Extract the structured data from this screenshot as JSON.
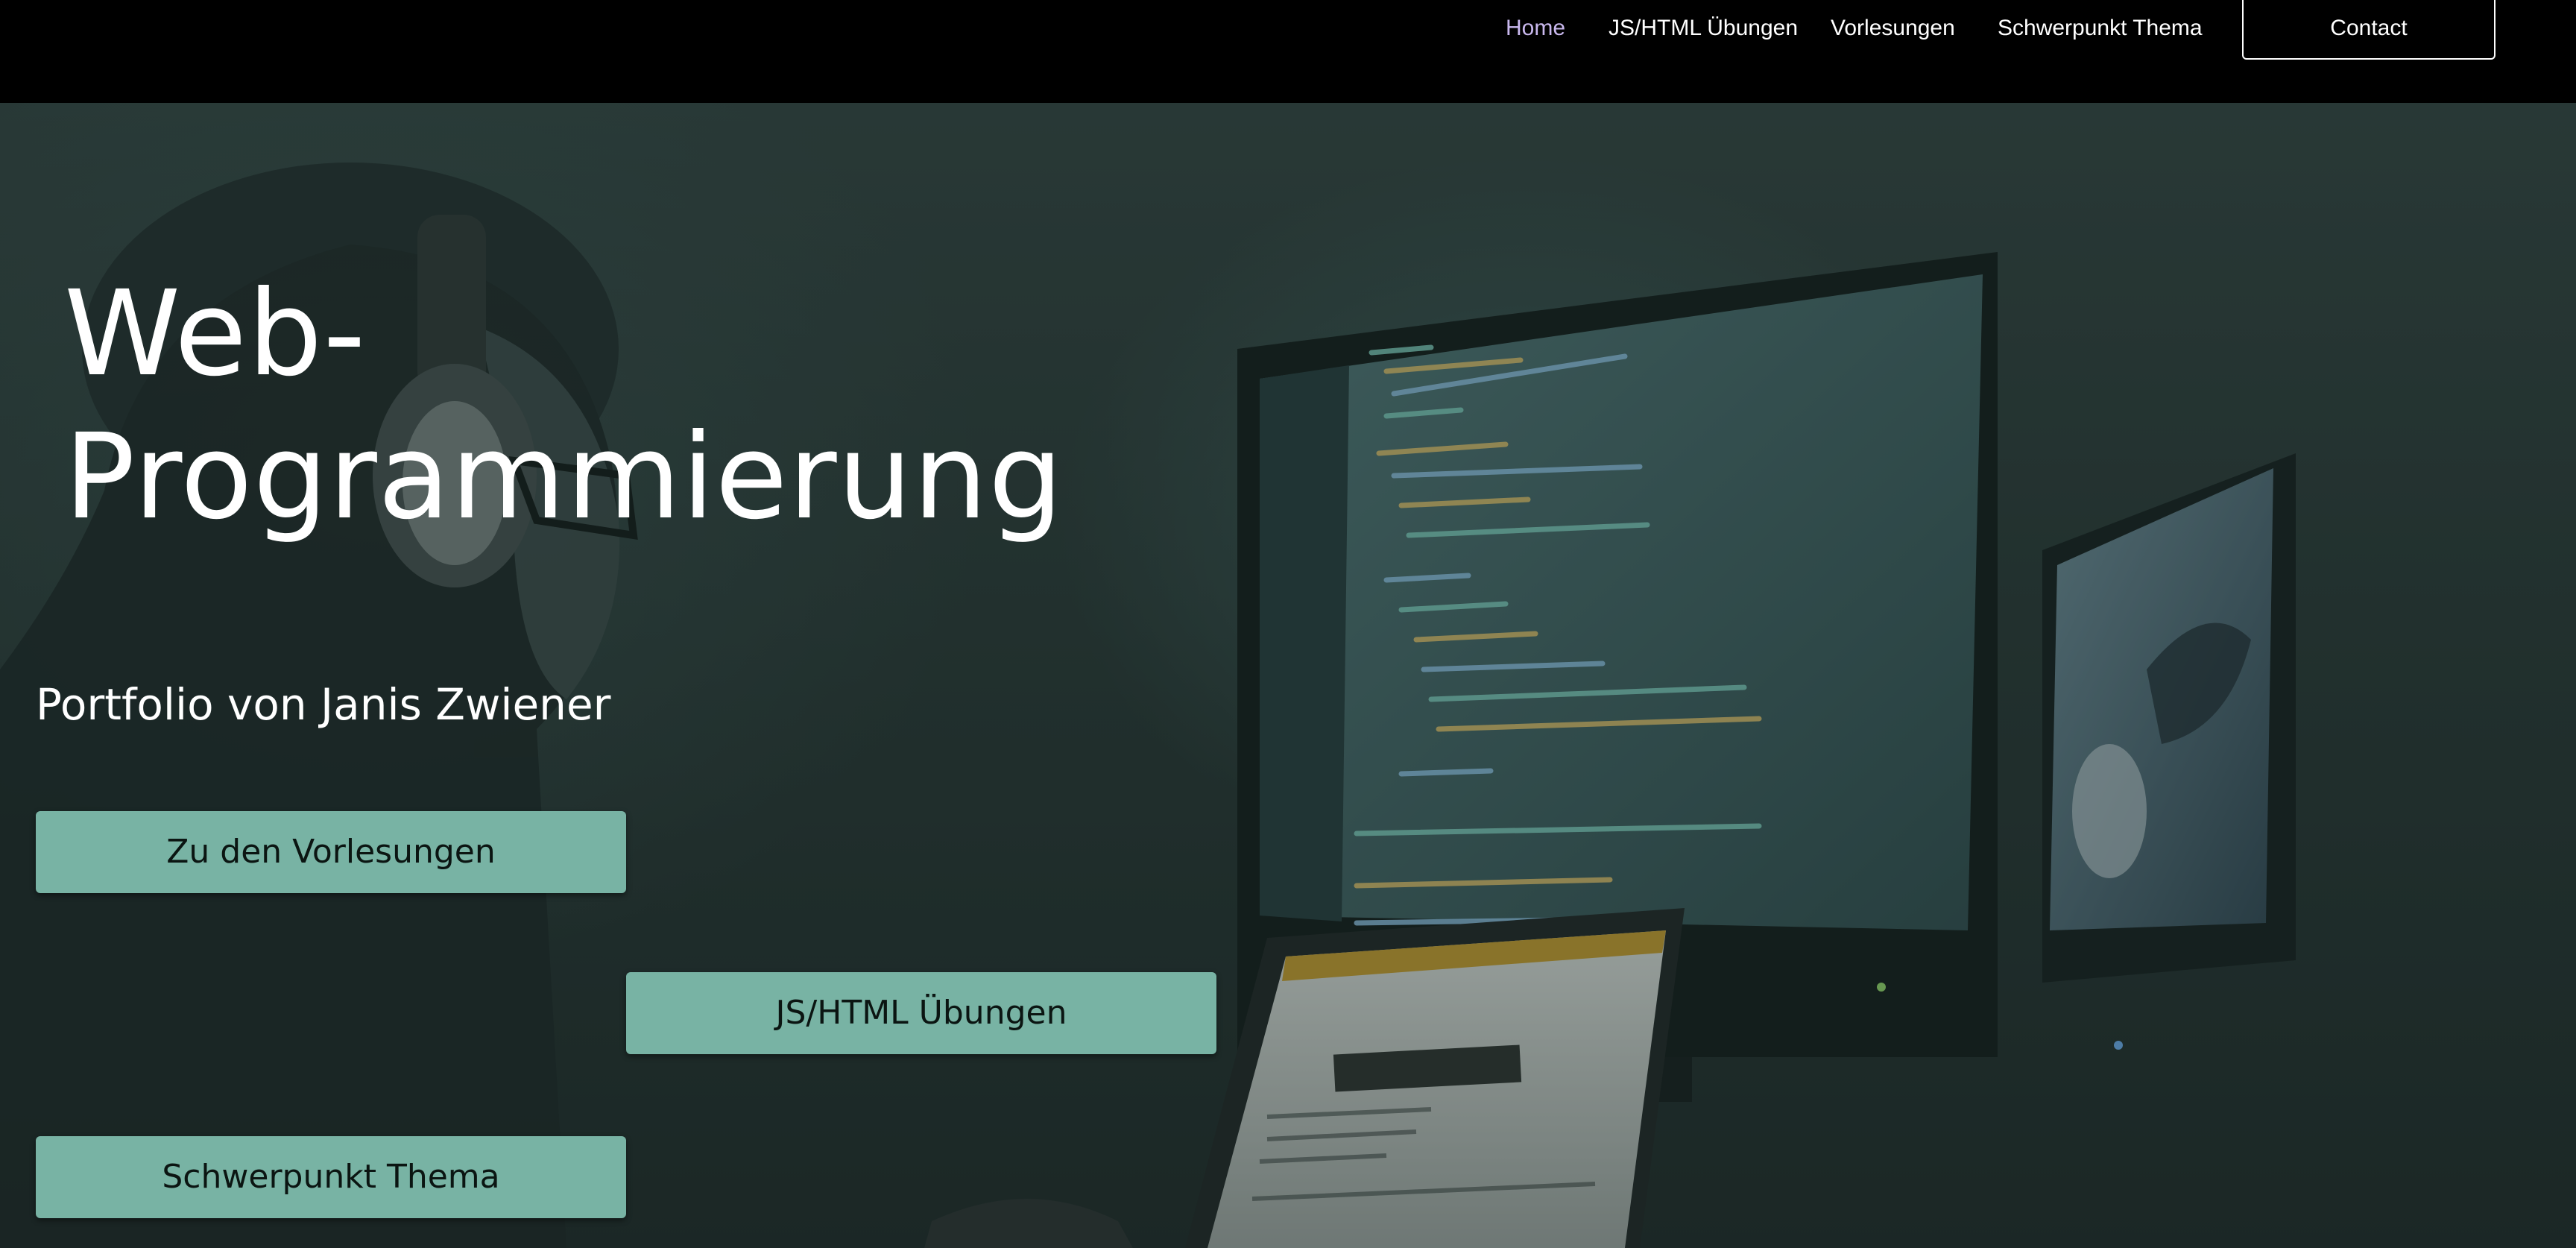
{
  "nav": {
    "links": [
      {
        "label": "Home",
        "active": true
      },
      {
        "label": "JS/HTML Übungen",
        "active": false
      },
      {
        "label": "Vorlesungen",
        "active": false
      },
      {
        "label": "Schwerpunkt Thema",
        "active": false
      }
    ],
    "contact_label": "Contact",
    "active_color": "#c9b8ee"
  },
  "hero": {
    "title": "Web-\nProgrammierung",
    "subtitle": "Portfolio von Janis Zwiener",
    "buttons": [
      {
        "label": "Zu den Vorlesungen"
      },
      {
        "label": "JS/HTML Übungen"
      },
      {
        "label": "Schwerpunkt Thema"
      }
    ],
    "button_color": "#78b3a4"
  }
}
